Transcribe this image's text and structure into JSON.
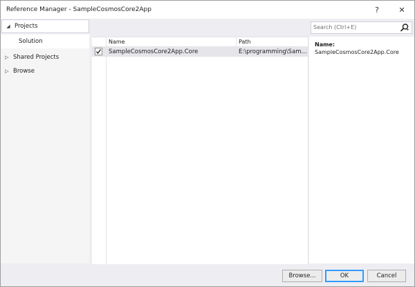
{
  "window": {
    "title": "Reference Manager - SampleCosmosCore2App",
    "help_glyph": "?",
    "close_glyph": "✕"
  },
  "sidebar": {
    "selected_group": "Projects",
    "selected_sub": "Solution",
    "groups": [
      {
        "label": "Shared Projects",
        "expanded": false
      },
      {
        "label": "Browse",
        "expanded": false
      }
    ]
  },
  "search": {
    "placeholder": "Search (Ctrl+E)",
    "icon": "search-icon"
  },
  "grid": {
    "columns": [
      "Name",
      "Path"
    ],
    "rows": [
      {
        "checked": true,
        "name": "SampleCosmosCore2App.Core",
        "path": "E:\\programming\\Sam..."
      }
    ]
  },
  "detail": {
    "name_label": "Name:",
    "name_value": "SampleCosmosCore2App.Core"
  },
  "buttons": {
    "browse": "Browse...",
    "ok": "OK",
    "cancel": "Cancel"
  },
  "colors": {
    "accent": "#3399ff",
    "selected_row": "#e6e6ea",
    "window_bg": "#eeeef2"
  }
}
